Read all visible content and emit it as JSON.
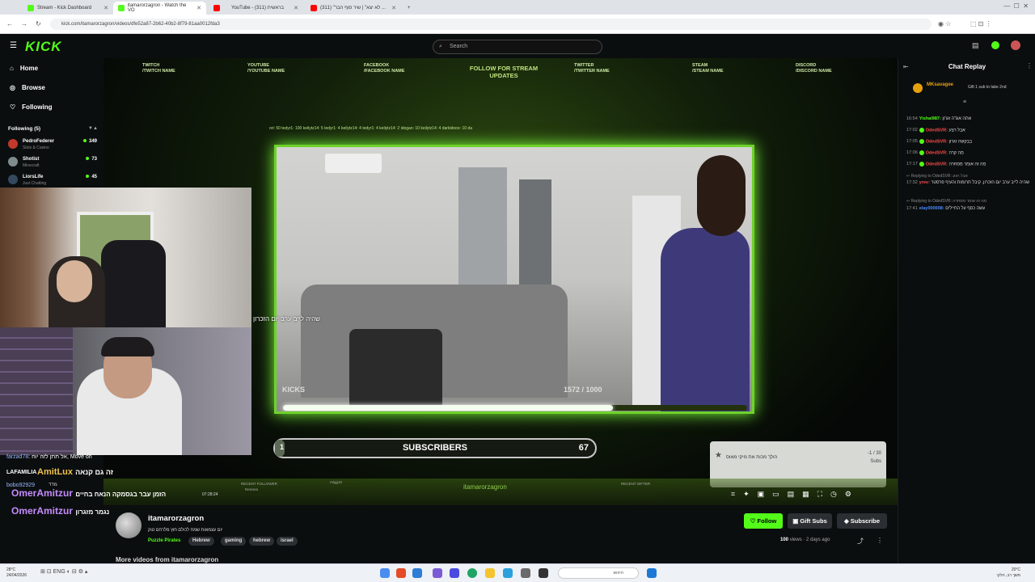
{
  "browser": {
    "tabs": [
      {
        "label": "Stream - Kick Dashboard",
        "color": "#53fc18"
      },
      {
        "label": "itamarorzagron - Watch the VO",
        "color": "#53fc18"
      },
      {
        "label": "",
        "color": "#ff0000"
      },
      {
        "label": "YouTube - בראשית (311)",
        "color": "#ff0000"
      },
      {
        "label": "(311) \"לא יצא\" | שיר סוף הבר ...",
        "color": "#ff0000"
      }
    ],
    "url": "kick.com/itamarorzagron/videos/dfe52a87-2b62-40b2-8f79-81aa0012fda3"
  },
  "nav": {
    "logo": "KICK",
    "search_placeholder": "Search"
  },
  "sidebar": {
    "items": [
      {
        "label": "Home",
        "icon": "home-icon"
      },
      {
        "label": "Browse",
        "icon": "compass-icon"
      },
      {
        "label": "Following",
        "icon": "heart-icon"
      }
    ],
    "following_header": "Following (5)",
    "following": [
      {
        "name": "PedroFederer",
        "game": "Slots & Casino",
        "viewers": "349",
        "color": "#c0392b"
      },
      {
        "name": "Shotist",
        "game": "Minecraft",
        "viewers": "73",
        "color": "#7f8c8d"
      },
      {
        "name": "LiorsLife",
        "game": "Just Chatting",
        "viewers": "45",
        "color": "#34495e"
      }
    ]
  },
  "stream": {
    "socials": [
      {
        "site": "TWITCH",
        "handle": "/TWITCH NAME"
      },
      {
        "site": "YOUTUBE",
        "handle": "/YOUTUBE NAME"
      },
      {
        "site": "FACEBOOK",
        "handle": "/FACEBOOK NAME"
      },
      {
        "site": "TWITTER",
        "handle": "/TWITTER NAME"
      },
      {
        "site": "STEAM",
        "handle": "/STEAM NAME"
      },
      {
        "site": "DISCORD",
        "handle": "/DISCORD NAME"
      }
    ],
    "follow_label": "FOLLOW FOR STREAM UPDATES",
    "ticker": "ori: 50 tedyr1: 100 keilytz14: 5 tedyr1: 4 keilytz14: 4 tedyr1: 4 keilytz14: 2 idogan: 10 keilytz14: 4 darkidooo: 10 da",
    "overlay_text": "שהיה לייב ערב יום הזכרון",
    "kicks_label": "KICKS",
    "kicks_value": "1572 / 1000",
    "kicks_progress": 0.71,
    "subs_current": "1",
    "subs_label": "SUBSCRIBERS",
    "subs_goal": "67",
    "subs_progress": 0.015,
    "goal_text": "הולך מכות את מיקי מאוס",
    "goal_count": "-1 / 30",
    "goal_unit": "Subs",
    "bottom_labels": [
      "RECENT FOLLOWER",
      "Remera",
      "rnigg10",
      "itamarorzagron",
      "RECENT GIFTER"
    ],
    "time": "07:28:24"
  },
  "overlay_chat": [
    {
      "user": "farzad78",
      "text": "אל תתן לזה יוח, Move on"
    },
    {
      "user": "LAFAMILIA",
      "text": ""
    },
    {
      "user": "AmitLux",
      "text": "זה גם קנאה"
    },
    {
      "user": "bobo92929",
      "text": "מדד"
    },
    {
      "user": "OmerAmitzur",
      "text": "הזמן עבר בגסמקה הנאח בחיים"
    },
    {
      "user": "OmerAmitzur",
      "text": "נגמר מזגרון"
    }
  ],
  "channel": {
    "name": "itamarorzagron",
    "title": "יום עצמאות שמח לכולם חוץ מלרחם טוק",
    "game": "Puzzle Pirates",
    "tags": [
      "Hebrew",
      "gaming",
      "hebrew",
      "israel"
    ],
    "follow": "Follow",
    "gift": "Gift Subs",
    "subscribe": "Subscribe",
    "views": "100",
    "views_label": "views",
    "age": "2 days ago",
    "more_videos": "More videos from itamarorzagron"
  },
  "chat": {
    "header": "Chat Replay",
    "pinned_user": "MKsavagee",
    "pinned_text": "Gift 1 sub to take 2nd",
    "messages": [
      {
        "time": "16:54",
        "user": "Yishai987:",
        "text": "אתה אגדה זגרון",
        "color": "#53fc18"
      },
      {
        "time": "17:02",
        "user": "OdedSVR:",
        "text": "אבל רצע",
        "color": "#ff4b4b"
      },
      {
        "time": "17:05",
        "user": "OdedSVR:",
        "text": "בבקשה זגרון",
        "color": "#ff4b4b"
      },
      {
        "time": "17:06",
        "user": "OdedSVR:",
        "text": "מה קרה",
        "color": "#ff4b4b"
      },
      {
        "time": "17:17",
        "user": "OdedSVR:",
        "text": "מה זה אומר מסחרה",
        "color": "#ff4b4b"
      },
      {
        "time": "17:32",
        "user": "yrev:",
        "text": "שהיה לייב ערב יום הזכרון, קיבל תרומות והעיף פרסטר",
        "color": "#ff4b4b",
        "reply": "Replying to OdedSVR: אבל רצע"
      },
      {
        "time": "17:41",
        "user": "elay000008:",
        "text": "עשה כסף על החיילים",
        "color": "#4b8bff",
        "reply": "Replying to OdedSVR: מה זה אומר מסחרה"
      }
    ]
  },
  "taskbar": {
    "left_temp": "28°C",
    "left_date": "24/04/2026",
    "search": "חיפוש",
    "clock": "20°C",
    "clock_sub": "משך רב, חלקי"
  }
}
